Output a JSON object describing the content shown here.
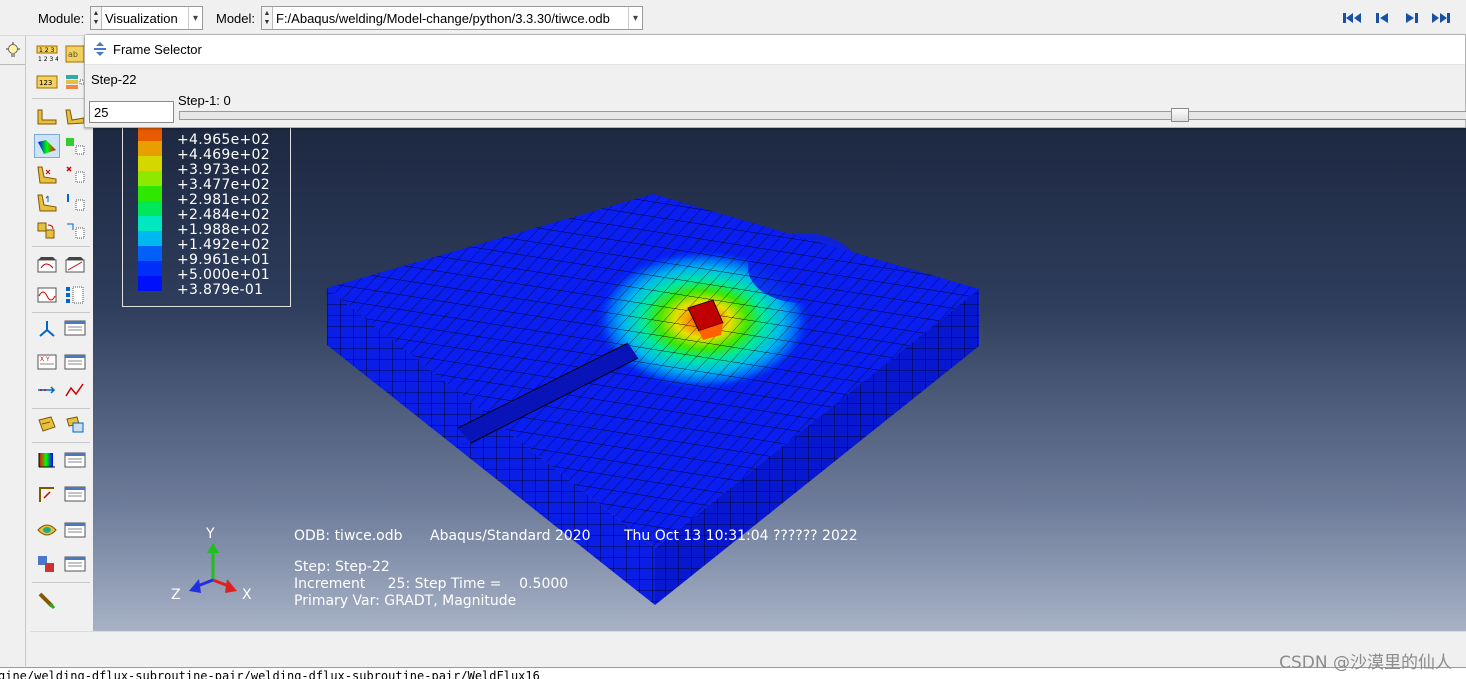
{
  "toolbar": {
    "module_label": "Module:",
    "module_value": "Visualization",
    "model_label": "Model:",
    "model_value": "F:/Abaqus/welding/Model-change/python/3.3.30/tiwce.odb",
    "nav_icons": [
      "first-frame-icon",
      "previous-frame-icon",
      "next-frame-icon",
      "last-frame-icon"
    ]
  },
  "frame_selector": {
    "title": "Frame Selector",
    "step_name": "Step-22",
    "frame_value": "25",
    "slider_label": "Step-1: 0"
  },
  "legend": {
    "labels": [
      "+4.965e+02",
      "+4.469e+02",
      "+3.973e+02",
      "+3.477e+02",
      "+2.981e+02",
      "+2.484e+02",
      "+1.988e+02",
      "+1.492e+02",
      "+9.961e+01",
      "+5.000e+01",
      "+3.879e-01"
    ],
    "colors": [
      "#ff0000",
      "#e85a00",
      "#e8a000",
      "#d4d800",
      "#8ee800",
      "#2ee800",
      "#00e85a",
      "#00e8c0",
      "#00b8f0",
      "#0060f8",
      "#0010f8"
    ]
  },
  "triad": {
    "y": "Y",
    "x": "X",
    "z": "Z"
  },
  "viewport_info": {
    "odb": "ODB: tiwce.odb",
    "solver": "Abaqus/Standard 2020",
    "date": "Thu Oct 13 10:31:04 ?????? 2022",
    "step": "Step: Step-22",
    "increment": "Increment     25: Step Time =    0.5000",
    "primary_var": "Primary Var: GRADT, Magnitude"
  },
  "command_line": "gine/welding-dflux-subroutine-pair/welding-dflux-subroutine-pair/WeldFlux16",
  "watermark": "CSDN @沙漠里的仙人"
}
